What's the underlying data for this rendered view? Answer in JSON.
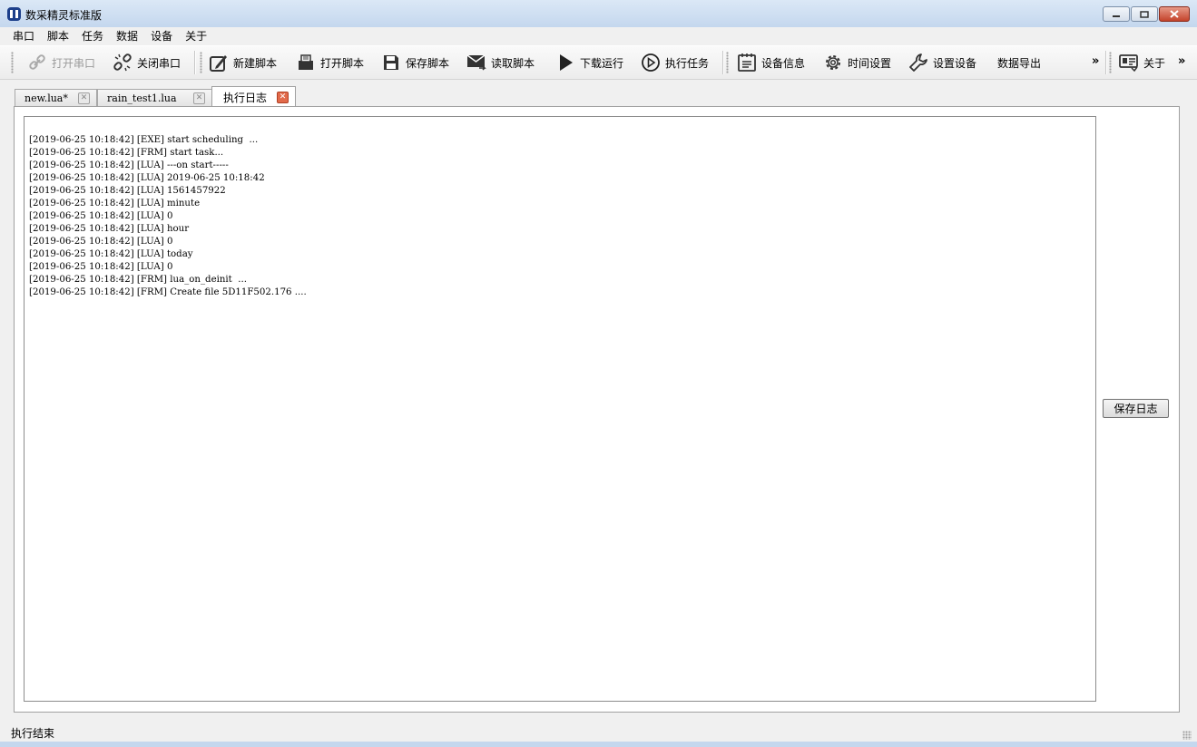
{
  "window": {
    "title": "数采精灵标准版"
  },
  "menu": [
    "串口",
    "脚本",
    "任务",
    "数据",
    "设备",
    "关于"
  ],
  "toolbar": {
    "open_port": "打开串口",
    "close_port": "关闭串口",
    "new_script": "新建脚本",
    "open_script": "打开脚本",
    "save_script": "保存脚本",
    "read_script": "读取脚本",
    "download_run": "下载运行",
    "run_task": "执行任务",
    "device_info": "设备信息",
    "time_settings": "时间设置",
    "set_device": "设置设备",
    "data_export": "数据导出",
    "about": "关于",
    "more": "»"
  },
  "tabs": [
    {
      "label": "new.lua*"
    },
    {
      "label": "rain_test1.lua"
    },
    {
      "label": "执行日志"
    }
  ],
  "log_lines": [
    "[2019-06-25 10:18:42] [EXE] start scheduling  ...",
    "[2019-06-25 10:18:42] [FRM] start task...",
    "[2019-06-25 10:18:42] [LUA] ---on start-----",
    "[2019-06-25 10:18:42] [LUA] 2019-06-25 10:18:42",
    "[2019-06-25 10:18:42] [LUA] 1561457922",
    "[2019-06-25 10:18:42] [LUA] minute",
    "[2019-06-25 10:18:42] [LUA] 0",
    "[2019-06-25 10:18:42] [LUA] hour",
    "[2019-06-25 10:18:42] [LUA] 0",
    "[2019-06-25 10:18:42] [LUA] today",
    "[2019-06-25 10:18:42] [LUA] 0",
    "[2019-06-25 10:18:42] [FRM] lua_on_deinit  ...",
    "[2019-06-25 10:18:42] [FRM] Create file 5D11F502.176 ...."
  ],
  "save_log_button": "保存日志",
  "status": "执行结束"
}
